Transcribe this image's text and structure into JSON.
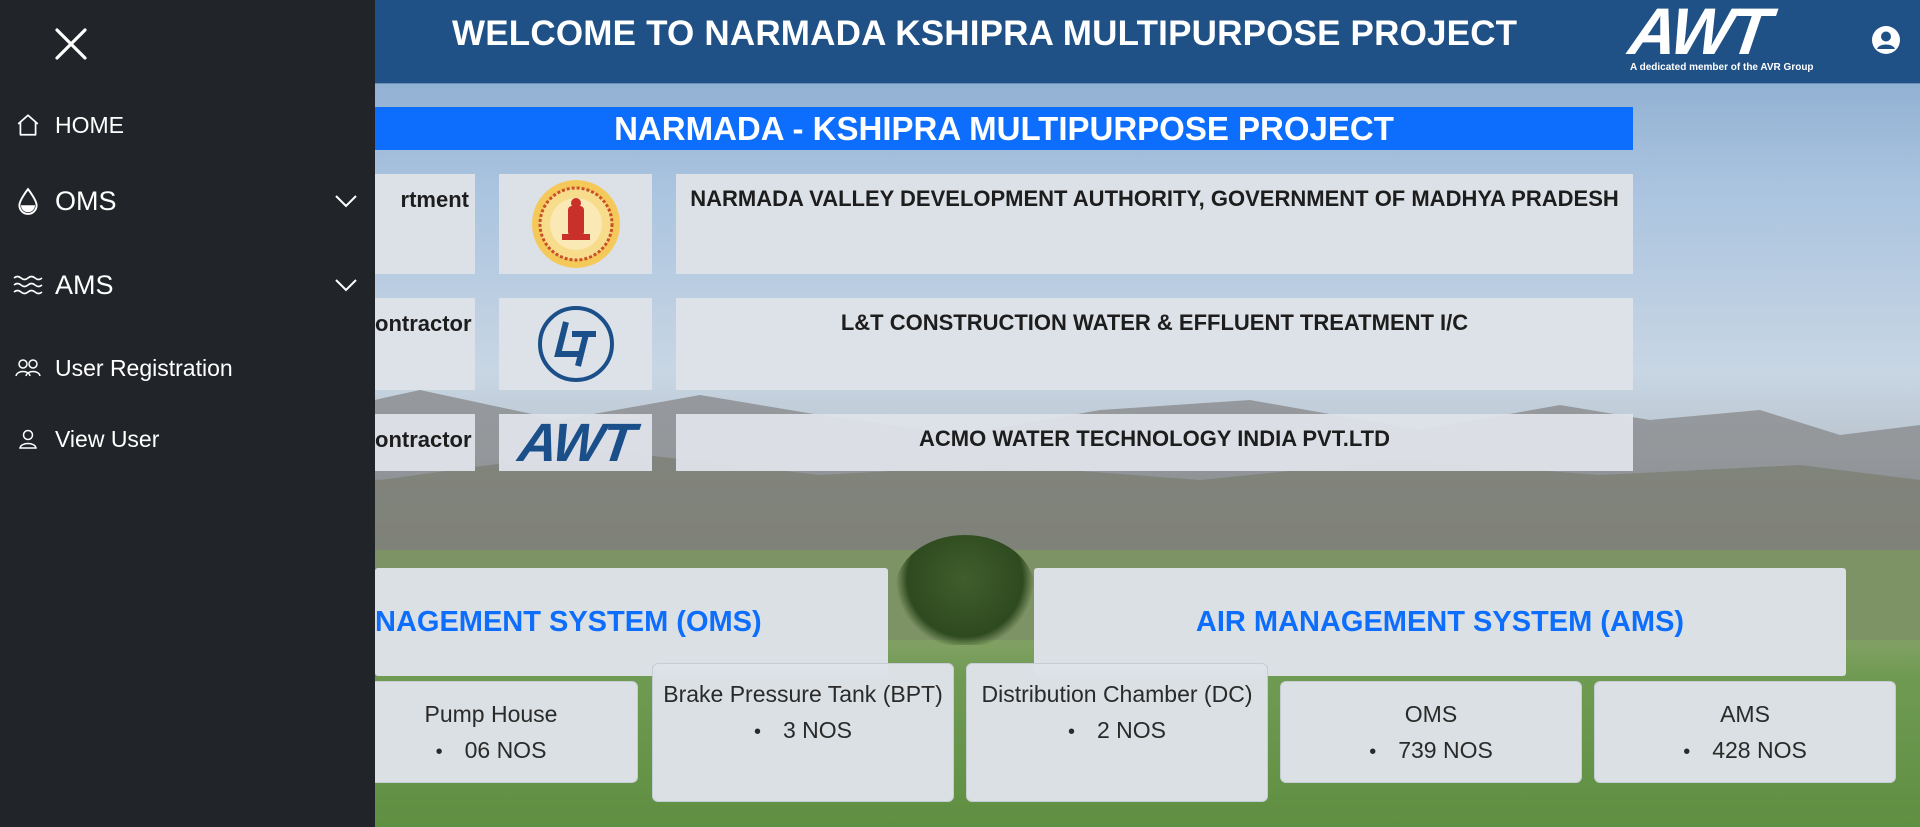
{
  "header": {
    "welcome_text": "WELCOME TO NARMADA KSHIPRA MULTIPURPOSE PROJECT",
    "logo_text": "AWT",
    "logo_tagline": "A dedicated member of the AVR Group",
    "user_icon": "user-circle-icon"
  },
  "sidebar": {
    "close_icon": "close-icon",
    "items": [
      {
        "label": "HOME",
        "icon": "home-icon"
      },
      {
        "label": "OMS",
        "icon": "water-drop-icon",
        "expandable": true
      },
      {
        "label": "AMS",
        "icon": "air-waves-icon",
        "expandable": true
      },
      {
        "label": "User Registration",
        "icon": "users-icon"
      },
      {
        "label": "View User",
        "icon": "user-icon"
      }
    ]
  },
  "banner": {
    "title": "NARMADA - KSHIPRA MULTIPURPOSE PROJECT"
  },
  "info_rows": [
    {
      "label": "rtment",
      "logo": "mp-government-emblem",
      "text": "NARMADA VALLEY DEVELOPMENT AUTHORITY, GOVERNMENT OF MADHYA PRADESH"
    },
    {
      "label": "ontractor",
      "logo": "lt-logo",
      "text": "L&T CONSTRUCTION WATER & EFFLUENT TREATMENT I/C"
    },
    {
      "label": "ontractor",
      "logo": "awt-logo",
      "logo_text": "AWT",
      "text": "ACMO WATER TECHNOLOGY INDIA PVT.LTD"
    }
  ],
  "systems": {
    "oms_title": "NAGEMENT SYSTEM (OMS)",
    "ams_title": "AIR MANAGEMENT SYSTEM (AMS)"
  },
  "stats": [
    {
      "title": "Pump House",
      "value": "06 NOS"
    },
    {
      "title": "Brake Pressure Tank (BPT)",
      "value": "3 NOS"
    },
    {
      "title": "Distribution Chamber (DC)",
      "value": "2 NOS"
    },
    {
      "title": "OMS",
      "value": "739 NOS"
    },
    {
      "title": "AMS",
      "value": "428 NOS"
    }
  ],
  "colors": {
    "header_bg": "#1f5186",
    "sidebar_bg": "#212529",
    "accent": "#0d6efd",
    "card_bg": "#dee2e8"
  }
}
